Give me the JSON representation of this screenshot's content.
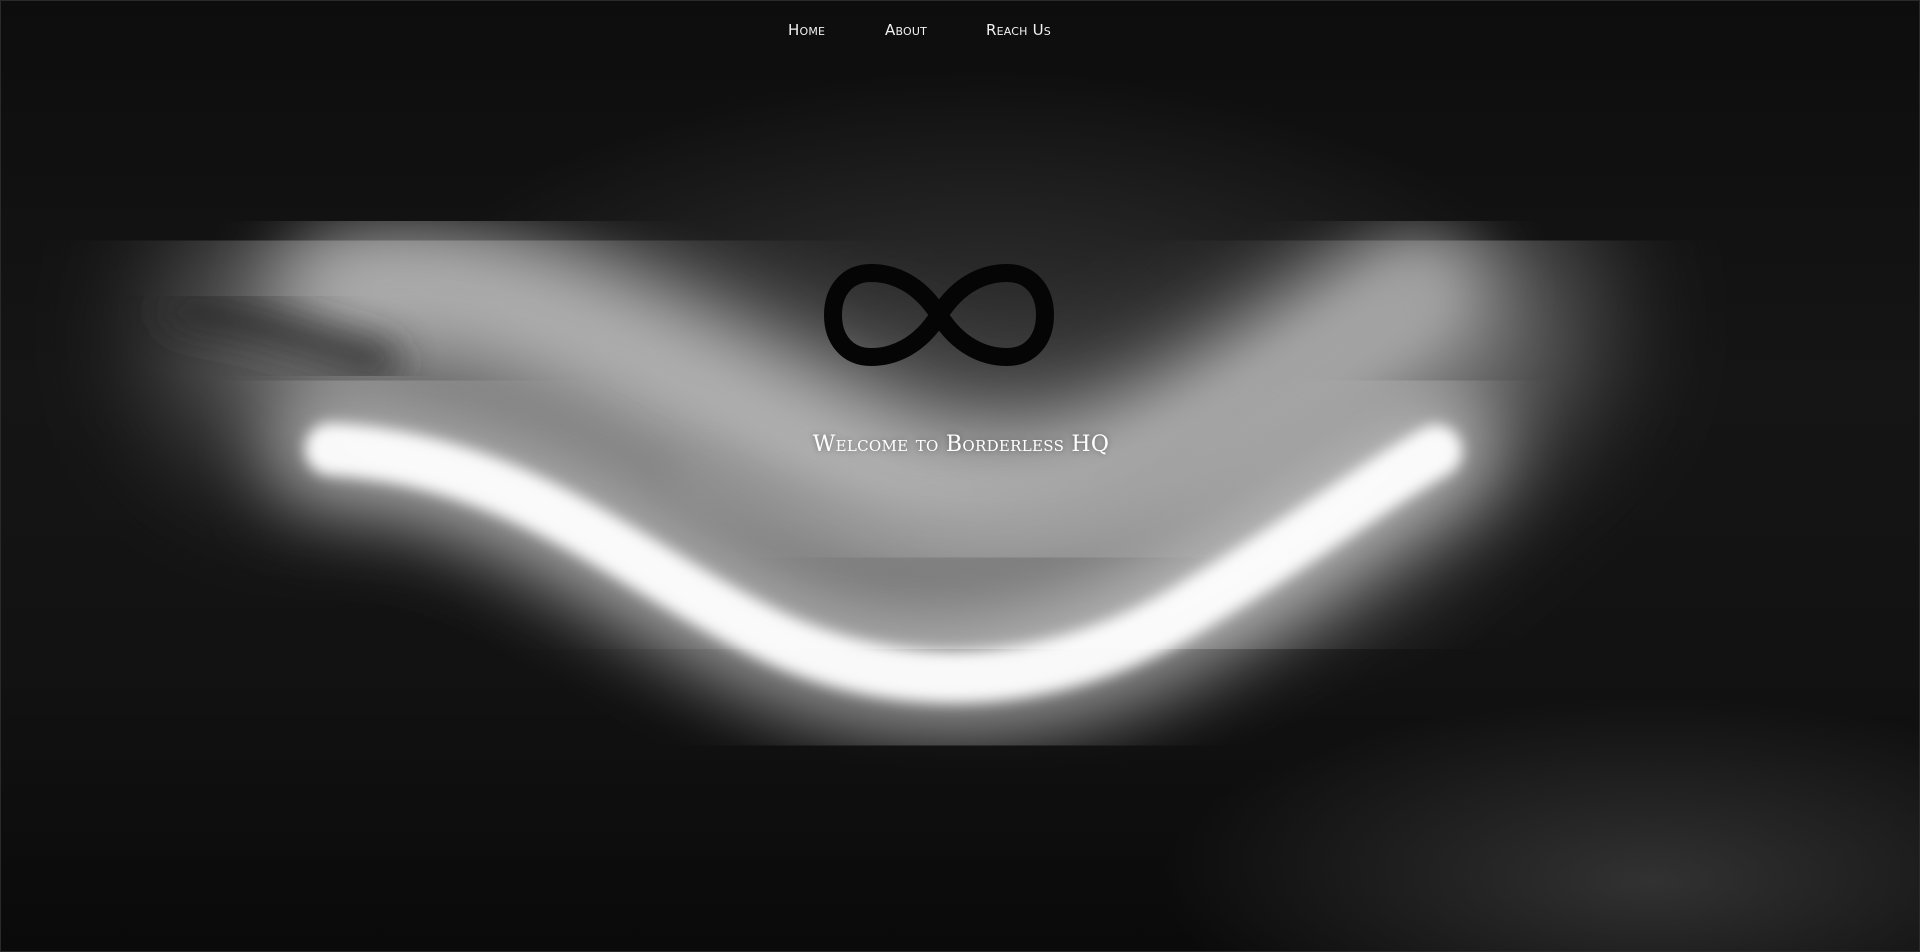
{
  "nav": {
    "items": [
      {
        "label": "Home"
      },
      {
        "label": "About"
      },
      {
        "label": "Reach Us"
      }
    ]
  },
  "hero": {
    "logo_icon": "infinity-icon",
    "welcome_text": "Welcome to Borderless HQ"
  },
  "colors": {
    "background": "#0b0b0b",
    "text": "#ffffff",
    "logo": "#050505"
  }
}
